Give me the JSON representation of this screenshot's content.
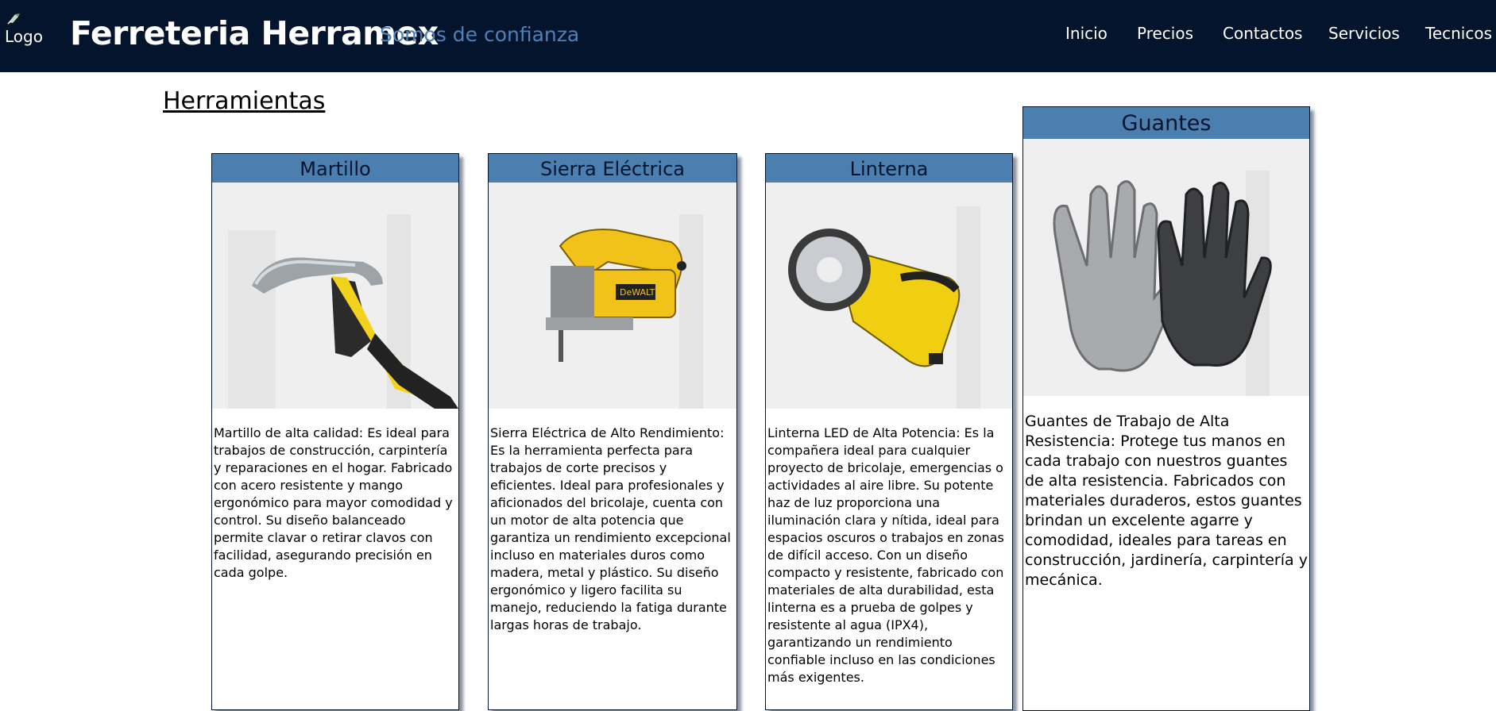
{
  "header": {
    "logo_alt": "Logo",
    "brand": "Ferreteria Herramex",
    "tagline": "Somos de confianza",
    "nav": [
      "Inicio",
      "Precios",
      "Contactos",
      "Servicios",
      "Tecnicos"
    ]
  },
  "section_title": "Herramientas",
  "products": [
    {
      "name": "Martillo",
      "description": "Martillo de alta calidad: Es ideal para trabajos de construcción, carpintería y reparaciones en el hogar. Fabricado con acero resistente y mango ergonómico para mayor comodidad y control. Su diseño balanceado permite clavar o retirar clavos con facilidad, asegurando precisión en cada golpe."
    },
    {
      "name": "Sierra Eléctrica",
      "description": "Sierra Eléctrica de Alto Rendimiento: Es la herramienta perfecta para trabajos de corte precisos y eficientes. Ideal para profesionales y aficionados del bricolaje, cuenta con un motor de alta potencia que garantiza un rendimiento excepcional incluso en materiales duros como madera, metal y plástico. Su diseño ergonómico y ligero facilita su manejo, reduciendo la fatiga durante largas horas de trabajo."
    },
    {
      "name": "Linterna",
      "description": "Linterna LED de Alta Potencia: Es la compañera ideal para cualquier proyecto de bricolaje, emergencias o actividades al aire libre. Su potente haz de luz proporciona una iluminación clara y nítida, ideal para espacios oscuros o trabajos en zonas de difícil acceso. Con un diseño compacto y resistente, fabricado con materiales de alta durabilidad, esta linterna es a prueba de golpes y resistente al agua (IPX4), garantizando un rendimiento confiable incluso en las condiciones más exigentes."
    },
    {
      "name": "Guantes",
      "description": "Guantes de Trabajo de Alta Resistencia: Protege tus manos en cada trabajo con nuestros guantes de alta resistencia. Fabricados con materiales duraderos, estos guantes brindan un excelente agarre y comodidad, ideales para tareas en construcción, jardinería, carpintería y mecánica."
    }
  ],
  "colors": {
    "header_bg": "#03142c",
    "tagline": "#4f81b8",
    "card_header": "#4a7fb0"
  }
}
